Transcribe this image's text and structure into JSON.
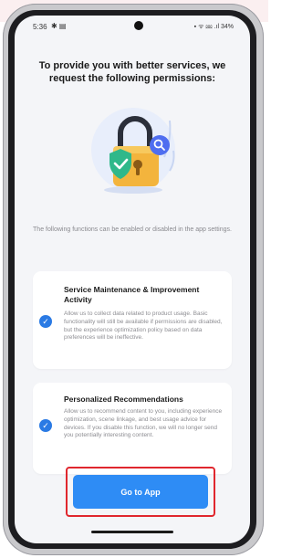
{
  "status_bar": {
    "time": "5:36",
    "left_icons": "✱ ▤",
    "right_text": "▪ ᯤ ⅏ .ıl 34%"
  },
  "header": {
    "title": "To provide you with better services, we request the following permissions:"
  },
  "illustration": {
    "icon": "lock-shield-search-illustration"
  },
  "note": "The following functions can be enabled or disabled in the app settings.",
  "permissions": [
    {
      "title": "Service Maintenance & Improvement Activity",
      "description": "Allow us to collect data related to product usage. Basic functionality will still be available if permissions are disabled, but the experience optimization policy based on data preferences will be ineffective.",
      "checked": true
    },
    {
      "title": "Personalized Recommendations",
      "description": "Allow us to recommend content to you, including experience optimization, scene linkage, and best usage advice for devices. If you disable this function, we will no longer send you potentially interesting content.",
      "checked": true
    }
  ],
  "action": {
    "go_label": "Go to App"
  },
  "colors": {
    "accent": "#2e8cf5",
    "check": "#2a7ae4",
    "highlight": "#e0272e"
  }
}
